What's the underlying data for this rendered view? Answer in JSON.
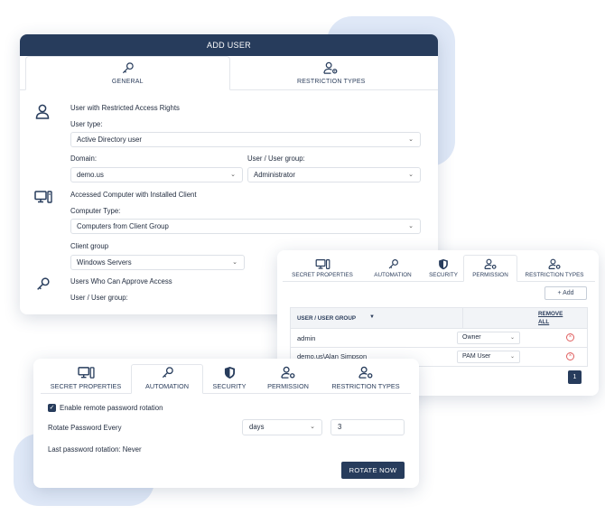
{
  "add_user": {
    "title": "ADD USER",
    "tabs": [
      {
        "label": "GENERAL",
        "icon": "key-icon",
        "active": true
      },
      {
        "label": "RESTRICTION TYPES",
        "icon": "user-gear-icon",
        "active": false
      }
    ],
    "user_section": {
      "heading": "User with Restricted Access Rights",
      "user_type_label": "User type:",
      "user_type_value": "Active Directory user",
      "domain_label": "Domain:",
      "domain_value": "demo.us",
      "user_group_label": "User / User group:",
      "user_group_value": "Administrator"
    },
    "computer_section": {
      "heading": "Accessed Computer with Installed Client",
      "computer_type_label": "Computer Type:",
      "computer_type_value": "Computers from Client Group",
      "client_group_label": "Client group",
      "client_group_value": "Windows Servers"
    },
    "approve_section": {
      "heading": "Users Who Can Approve Access",
      "user_group_label": "User / User group:"
    }
  },
  "permission_card": {
    "tabs": [
      {
        "label": "SECRET PROPERTIES",
        "icon": "computer-icon",
        "active": false
      },
      {
        "label": "AUTOMATION",
        "icon": "key-icon",
        "active": false
      },
      {
        "label": "SECURITY",
        "icon": "shield-icon",
        "active": false
      },
      {
        "label": "PERMISSION",
        "icon": "user-gear-icon",
        "active": true
      },
      {
        "label": "RESTRICTION TYPES",
        "icon": "user-gear-icon",
        "active": false
      }
    ],
    "add_label": "+ Add",
    "header_user": "USER / USER GROUP",
    "header_remove_line1": "REMOVE",
    "header_remove_line2": "ALL",
    "rows": [
      {
        "name": "admin",
        "role": "Owner"
      },
      {
        "name": "demo.us\\Alan Simpson",
        "role": "PAM User"
      }
    ],
    "page": "1"
  },
  "automation_card": {
    "tabs": [
      {
        "label": "SECRET PROPERTIES",
        "icon": "computer-icon",
        "active": false
      },
      {
        "label": "AUTOMATION",
        "icon": "key-icon",
        "active": true
      },
      {
        "label": "SECURITY",
        "icon": "shield-icon",
        "active": false
      },
      {
        "label": "PERMISSION",
        "icon": "user-gear-icon",
        "active": false
      },
      {
        "label": "RESTRICTION TYPES",
        "icon": "user-gear-icon",
        "active": false
      }
    ],
    "enable_label": "Enable remote password rotation",
    "rotate_every_label": "Rotate Password Every",
    "period_unit": "days",
    "period_value": "3",
    "last_rotation": "Last password rotation: Never",
    "rotate_button": "ROTATE NOW"
  },
  "colors": {
    "primary": "#273c5c",
    "accent_bg": "#dfe8f7",
    "remove": "#e06060"
  }
}
